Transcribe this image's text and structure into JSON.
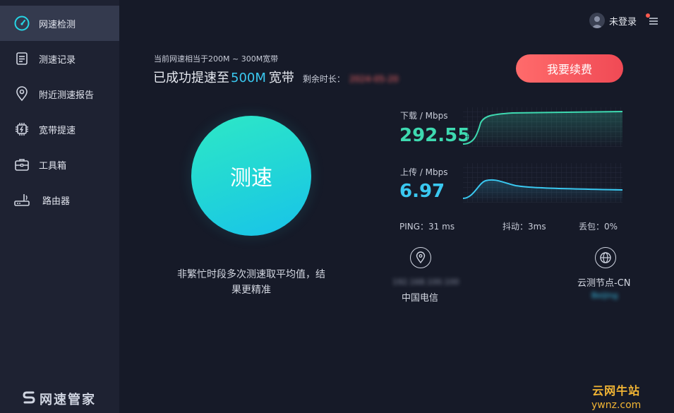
{
  "sidebar": {
    "items": [
      {
        "label": "网速检测",
        "icon": "speedometer-icon",
        "active": true
      },
      {
        "label": "测速记录",
        "icon": "document-icon",
        "active": false
      },
      {
        "label": "附近测速报告",
        "icon": "location-pin-icon",
        "active": false
      },
      {
        "label": "宽带提速",
        "icon": "chip-icon",
        "active": false
      },
      {
        "label": "工具箱",
        "icon": "toolbox-icon",
        "active": false
      },
      {
        "label": "路由器",
        "icon": "router-icon",
        "active": false
      }
    ],
    "brand": "网速管家"
  },
  "header": {
    "user_label": "未登录",
    "menu_icon": "hamburger-menu-icon"
  },
  "status": {
    "speed_note": "当前网速相当于200M ~ 300M宽带",
    "boost_prefix": "已成功提速至",
    "boost_speed": "500M",
    "boost_suffix": "宽带",
    "remaining_label": "剩余时长：",
    "remaining_value": "2024-05-20"
  },
  "renew_button": "我要续费",
  "test_button": "测速",
  "tip": "非繁忙时段多次测速取平均值，结果更精准",
  "download": {
    "label": "下载 / Mbps",
    "value": "292.55",
    "color": "#3ed9b0"
  },
  "upload": {
    "label": "上传 / Mbps",
    "value": "6.97",
    "color": "#3ac8f0"
  },
  "stats": {
    "ping": "PING：31 ms",
    "jitter": "抖动：3ms",
    "loss": "丢包：0%"
  },
  "isp": {
    "ip": "192.168.100.100",
    "name": "中国电信",
    "icon": "location-icon"
  },
  "node": {
    "name": "云测节点-CN",
    "detail": "Beijing",
    "icon": "globe-icon"
  },
  "watermark": {
    "cn": "云网牛站",
    "url": "ywnz.com"
  }
}
